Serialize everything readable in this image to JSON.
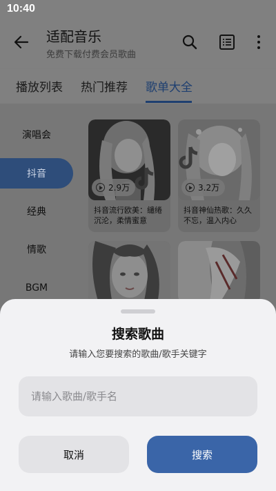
{
  "status": {
    "time": "10:40"
  },
  "header": {
    "title": "适配音乐",
    "subtitle": "免费下载付费会员歌曲"
  },
  "tabs": [
    {
      "label": "播放列表"
    },
    {
      "label": "热门推荐"
    },
    {
      "label": "歌单大全",
      "active": true
    }
  ],
  "sidebar": {
    "items": [
      {
        "label": "演唱会"
      },
      {
        "label": "抖音",
        "active": true
      },
      {
        "label": "经典"
      },
      {
        "label": "情歌"
      },
      {
        "label": "BGM"
      }
    ]
  },
  "playlists": [
    {
      "plays": "2.9万",
      "title": "抖音流行欧美：缱绻沉沦，柔情蜜意"
    },
    {
      "plays": "3.2万",
      "title": "抖音神仙热歌：久久不忘，温入内心"
    },
    {
      "plays": "",
      "title": ""
    },
    {
      "plays": "",
      "title": ""
    }
  ],
  "dialog": {
    "title": "搜索歌曲",
    "subtitle": "请输入您要搜索的歌曲/歌手关键字",
    "input_placeholder": "请输入歌曲/歌手名",
    "input_value": "",
    "cancel_label": "取消",
    "search_label": "搜索"
  },
  "colors": {
    "accent": "#3a65a8",
    "tab_active": "#1e3f70",
    "sidebar_active": "#2e4d7a"
  }
}
